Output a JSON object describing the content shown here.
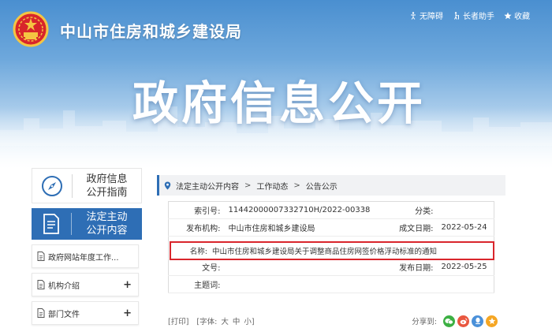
{
  "header": {
    "site_title": "中山市住房和城乡建设局",
    "hero_title": "政府信息公开",
    "tools": [
      {
        "label": "无障碍",
        "icon": "accessibility-icon"
      },
      {
        "label": "长者助手",
        "icon": "elder-assist-icon"
      },
      {
        "label": "收藏",
        "icon": "star-icon"
      }
    ]
  },
  "sidebar": {
    "guide": {
      "line1": "政府信息",
      "line2": "公开指南",
      "icon": "compass-icon"
    },
    "active": {
      "line1": "法定主动",
      "line2": "公开内容",
      "icon": "document-icon"
    },
    "items": [
      {
        "label": "政府网站年度工作...",
        "has_plus": false
      },
      {
        "label": "机构介绍",
        "has_plus": true
      },
      {
        "label": "部门文件",
        "has_plus": true
      }
    ],
    "plus_symbol": "+"
  },
  "breadcrumb": {
    "items": [
      "法定主动公开内容",
      "工作动态",
      "公告公示"
    ],
    "separator": ">"
  },
  "info": {
    "index_label": "索引号:",
    "index_value": "11442000007332710H/2022-00338",
    "category_label": "分类:",
    "category_value": "",
    "publisher_label": "发布机构:",
    "publisher_value": "中山市住房和城乡建设局",
    "created_label": "成文日期:",
    "created_value": "2022-05-24",
    "name_label": "名称:",
    "name_value": "中山市住房和城乡建设局关于调整商品住房网签价格浮动标准的通知",
    "docno_label": "文号:",
    "docno_value": "",
    "published_label": "发布日期:",
    "published_value": "2022-05-25",
    "subject_label": "主题词:",
    "subject_value": ""
  },
  "footer": {
    "print": "[打印]",
    "font_label": "[字体:",
    "font_large": "大",
    "font_medium": "中",
    "font_small": "小]",
    "share_label": "分享到:"
  },
  "colors": {
    "accent": "#2e6eb5",
    "highlight_border": "#d9262c",
    "share": [
      "#3cb043",
      "#e9573f",
      "#4a90d9",
      "#f5a623"
    ]
  }
}
